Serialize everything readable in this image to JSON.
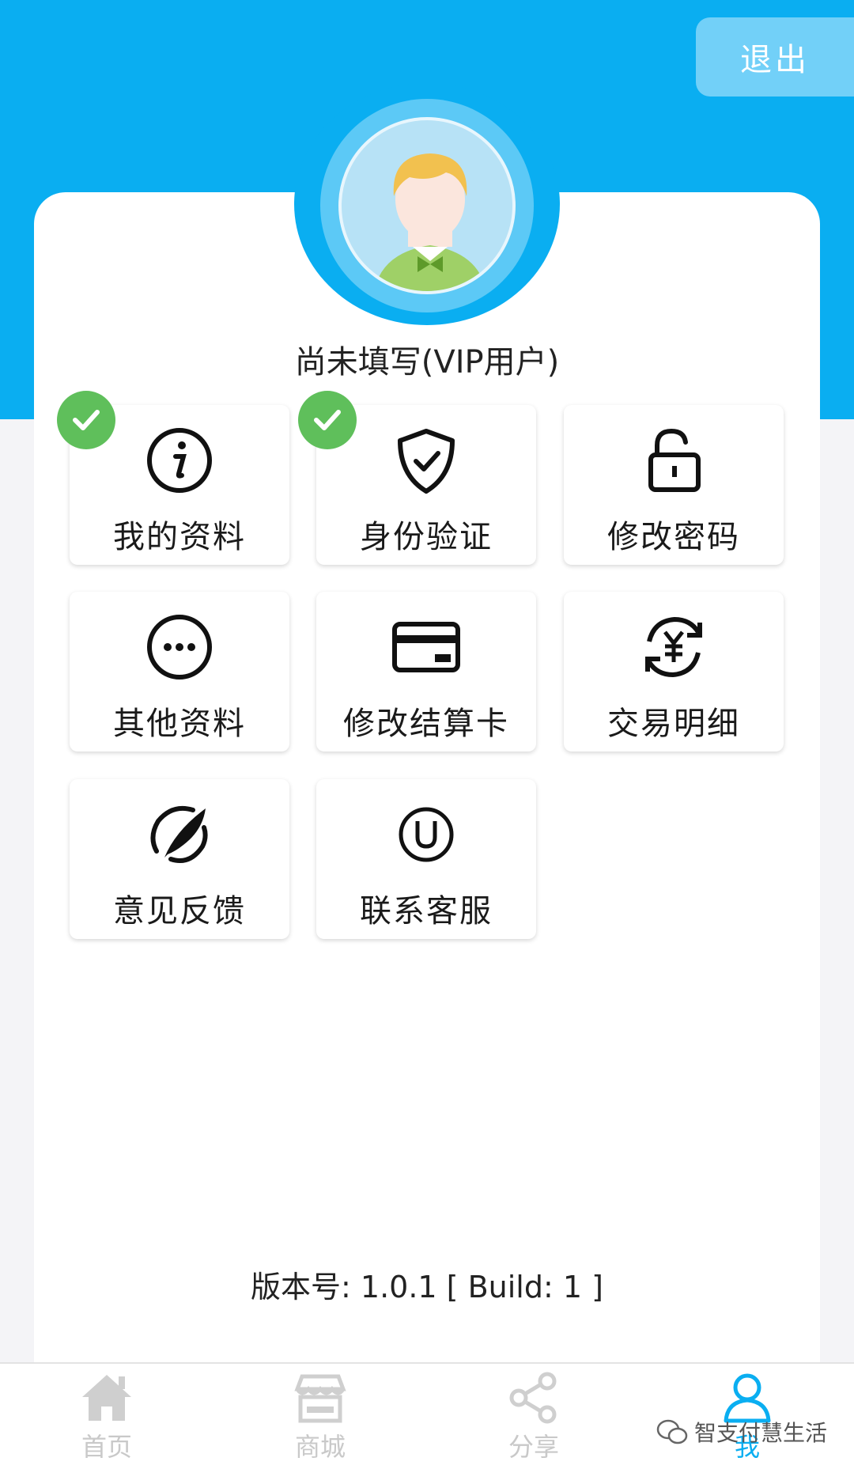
{
  "header": {
    "logout_label": "退出"
  },
  "profile": {
    "name": "尚未填写(VIP用户)"
  },
  "menu": [
    {
      "label": "我的资料",
      "icon": "info-icon",
      "verified": true
    },
    {
      "label": "身份验证",
      "icon": "shield-check-icon",
      "verified": true
    },
    {
      "label": "修改密码",
      "icon": "unlock-icon",
      "verified": false
    },
    {
      "label": "其他资料",
      "icon": "more-dots-icon",
      "verified": false
    },
    {
      "label": "修改结算卡",
      "icon": "card-icon",
      "verified": false
    },
    {
      "label": "交易明细",
      "icon": "yuan-exchange-icon",
      "verified": false
    },
    {
      "label": "意见反馈",
      "icon": "feather-icon",
      "verified": false
    },
    {
      "label": "联系客服",
      "icon": "support-icon",
      "verified": false
    }
  ],
  "version": "版本号: 1.0.1 [ Build: 1 ]",
  "tabs": [
    {
      "label": "首页",
      "icon": "home-icon",
      "active": false
    },
    {
      "label": "商城",
      "icon": "store-icon",
      "active": false
    },
    {
      "label": "分享",
      "icon": "share-icon",
      "active": false
    },
    {
      "label": "我",
      "icon": "user-icon",
      "active": true
    }
  ],
  "watermark": "智支付慧生活",
  "colors": {
    "primary": "#0aaef1",
    "check": "#5fbf5b",
    "logout_bg": "#72d0f8"
  }
}
